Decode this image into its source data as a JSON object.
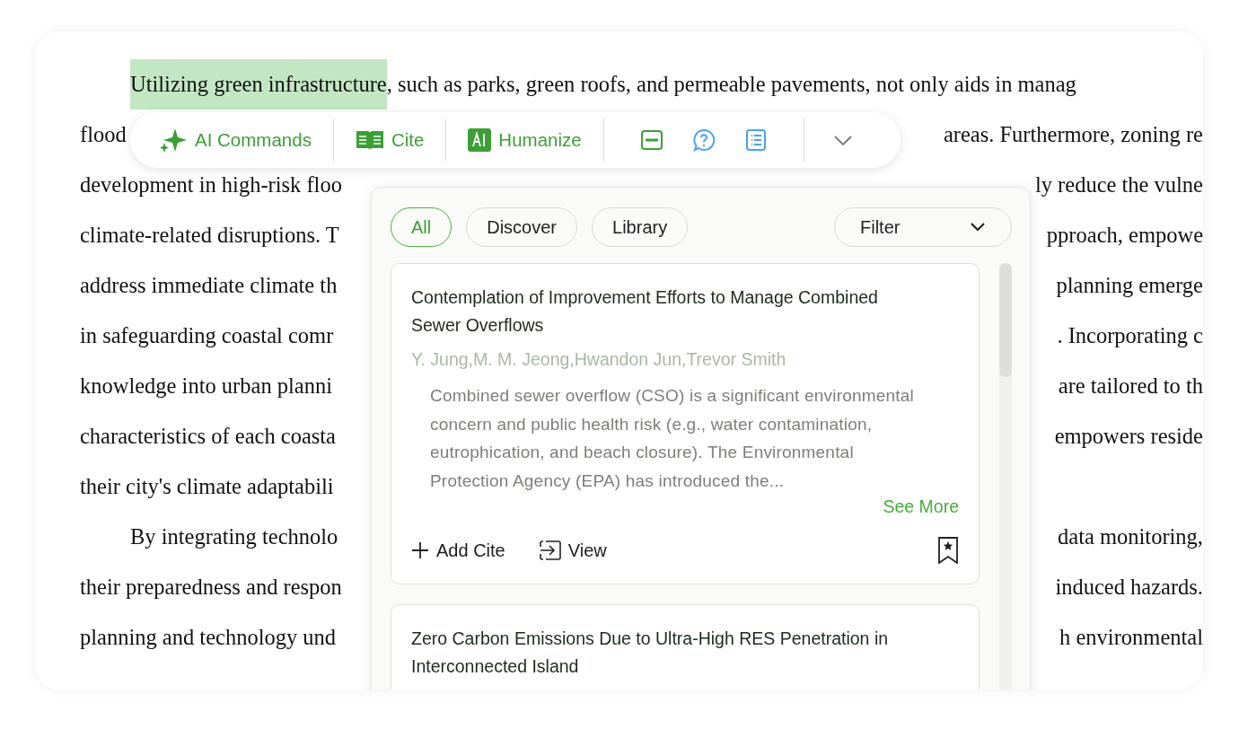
{
  "document": {
    "lines": [
      {
        "indent": true,
        "highlight": "Utilizing green infrastructure",
        "left": ", such as parks, green roofs, and permeable pavements, not only aids in manag"
      },
      {
        "left": "flood",
        "right": "areas. Furthermore, zoning re"
      },
      {
        "left": "development in high-risk floo",
        "right": "ly reduce the vulne"
      },
      {
        "left": "climate-related disruptions. T",
        "right": "pproach, empowe"
      },
      {
        "left": "address immediate climate th",
        "right": "planning emerge"
      },
      {
        "left": "in safeguarding coastal comr",
        "right": ". Incorporating c"
      },
      {
        "left": "knowledge into urban planni",
        "right": "are tailored to th"
      },
      {
        "left": "characteristics of each coasta",
        "right": "empowers reside"
      },
      {
        "left": "their city's climate adaptabili"
      },
      {
        "indent": true,
        "left": "By integrating technolo",
        "right": "data monitoring,"
      },
      {
        "left": "their preparedness and respon",
        "right": "induced hazards."
      },
      {
        "left": "planning and technology und",
        "right": "h environmental"
      }
    ]
  },
  "toolbar": {
    "items": [
      {
        "kind": "labeled",
        "label": "AI Commands"
      },
      {
        "kind": "labeled",
        "label": "Cite"
      },
      {
        "kind": "labeled",
        "label": "Humanize"
      },
      {
        "kind": "icons"
      },
      {
        "kind": "more"
      }
    ]
  },
  "panel": {
    "tabs": [
      {
        "label": "All",
        "selected": true
      },
      {
        "label": "Discover",
        "selected": false
      },
      {
        "label": "Library",
        "selected": false
      }
    ],
    "filter": {
      "label": "Filter"
    },
    "results": [
      {
        "title": "Contemplation of Improvement Efforts to Manage Combined Sewer Overflows",
        "authors": "Y. Jung,M. M. Jeong,Hwandon Jun,Trevor Smith",
        "abstract": "Combined sewer overflow (CSO) is a significant environmental concern and public health risk (e.g., water contamination, eutrophication, and beach closure). The Environmental Protection Agency (EPA) has introduced the...",
        "see_more": "See More",
        "actions": [
          "Add Cite",
          "View"
        ]
      },
      {
        "title": "Zero Carbon Emissions Due to Ultra-High RES Penetration in Interconnected Island"
      }
    ]
  }
}
